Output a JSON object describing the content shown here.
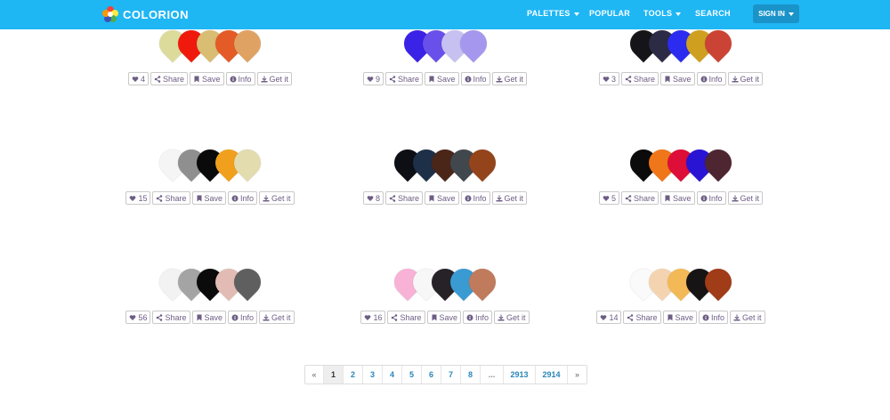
{
  "brand": {
    "name": "COLORION"
  },
  "nav": {
    "palettes": "PALETTES",
    "popular": "POPULAR",
    "tools": "TOOLS",
    "search": "SEARCH",
    "signin": "SIGN IN"
  },
  "actions": {
    "share": "Share",
    "save": "Save",
    "info": "Info",
    "get": "Get it"
  },
  "palettes": [
    {
      "likes": "4",
      "colors": [
        "#dcdb9b",
        "#f01a0c",
        "#d9bd72",
        "#e45b27",
        "#e0a262"
      ]
    },
    {
      "likes": "9",
      "colors": [
        "#3a22e6",
        "#6a50ea",
        "#c6c1f0",
        "#a596ee"
      ]
    },
    {
      "likes": "3",
      "colors": [
        "#151419",
        "#2b2b45",
        "#2b2cf0",
        "#cfa01f",
        "#cb4334"
      ]
    },
    {
      "likes": "15",
      "colors": [
        "#f5f5f5",
        "#8f8f8f",
        "#0a0a0a",
        "#f0a01c",
        "#e2dcae"
      ]
    },
    {
      "likes": "8",
      "colors": [
        "#0d0f14",
        "#1e2f48",
        "#4a2619",
        "#41484d",
        "#93441b"
      ]
    },
    {
      "likes": "5",
      "colors": [
        "#0b0b0b",
        "#f0761a",
        "#dd0e37",
        "#2a14d4",
        "#4d2631"
      ]
    },
    {
      "likes": "56",
      "colors": [
        "#f2f2f2",
        "#a4a4a4",
        "#0b0b0b",
        "#e2bcb4",
        "#5f5f5f"
      ]
    },
    {
      "likes": "16",
      "colors": [
        "#f7b2d6",
        "#f7f7f7",
        "#262228",
        "#3a9bd3",
        "#c07a5c"
      ]
    },
    {
      "likes": "14",
      "colors": [
        "#fafafa",
        "#f4d4b0",
        "#f2b956",
        "#161414",
        "#a03c18"
      ]
    }
  ],
  "pagination": [
    "«",
    "1",
    "2",
    "3",
    "4",
    "5",
    "6",
    "7",
    "8",
    "...",
    "2913",
    "2914",
    "»"
  ],
  "pagination_active": "1"
}
